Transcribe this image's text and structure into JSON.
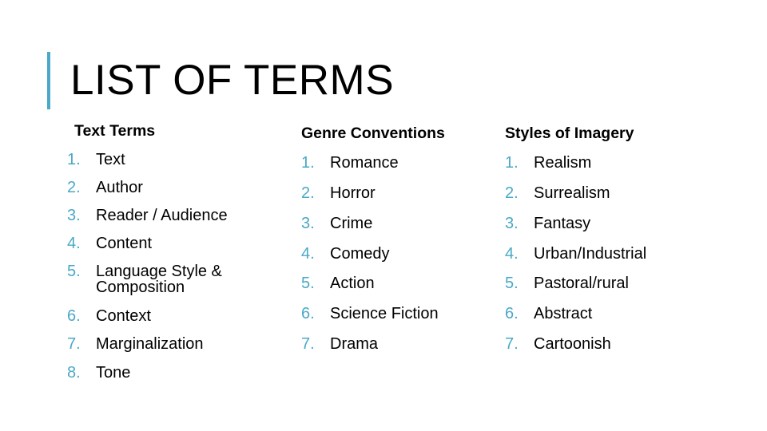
{
  "title": "LIST OF TERMS",
  "accent_color": "#4aa8c8",
  "columns": [
    {
      "header": "Text Terms",
      "items": [
        {
          "num": "1.",
          "label": "Text"
        },
        {
          "num": "2.",
          "label": "Author"
        },
        {
          "num": "3.",
          "label": "Reader / Audience"
        },
        {
          "num": "4.",
          "label": "Content"
        },
        {
          "num": "5.",
          "label": "Language Style &\nComposition"
        },
        {
          "num": "6.",
          "label": "Context"
        },
        {
          "num": "7.",
          "label": "Marginalization"
        },
        {
          "num": "8.",
          "label": "Tone"
        }
      ]
    },
    {
      "header": "Genre Conventions",
      "items": [
        {
          "num": "1.",
          "label": "Romance"
        },
        {
          "num": "2.",
          "label": "Horror"
        },
        {
          "num": "3.",
          "label": "Crime"
        },
        {
          "num": "4.",
          "label": "Comedy"
        },
        {
          "num": "5.",
          "label": "Action"
        },
        {
          "num": "6.",
          "label": "Science Fiction"
        },
        {
          "num": "7.",
          "label": "Drama"
        }
      ]
    },
    {
      "header": "Styles of Imagery",
      "items": [
        {
          "num": "1.",
          "label": "Realism"
        },
        {
          "num": "2.",
          "label": "Surrealism"
        },
        {
          "num": "3.",
          "label": "Fantasy"
        },
        {
          "num": "4.",
          "label": "Urban/Industrial"
        },
        {
          "num": "5.",
          "label": "Pastoral/rural"
        },
        {
          "num": "6.",
          "label": "Abstract"
        },
        {
          "num": "7.",
          "label": "Cartoonish"
        }
      ]
    }
  ]
}
